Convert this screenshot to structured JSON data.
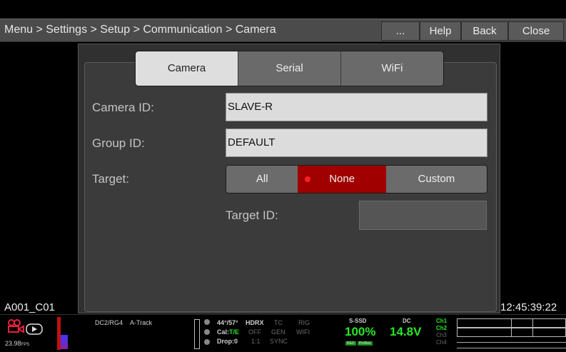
{
  "topbar": {
    "breadcrumb": "Menu > Settings > Setup > Communication > Camera",
    "buttons": [
      "...",
      "Help",
      "Back",
      "Close"
    ]
  },
  "tabs": [
    "Camera",
    "Serial",
    "WiFi"
  ],
  "form": {
    "camera_id_label": "Camera ID:",
    "camera_id_value": "SLAVE-R",
    "group_id_label": "Group ID:",
    "group_id_value": "DEFAULT",
    "target_label": "Target:",
    "target_options": [
      "All",
      "None",
      "Custom"
    ],
    "target_selected": "None",
    "target_id_label": "Target ID:",
    "target_id_value": ""
  },
  "clip_name": "A001_C01",
  "timecode": "12:45:39:22",
  "status": {
    "fps": "23.98",
    "fps_unit": "FPS",
    "storage_label": "DC2/RG4",
    "track_label": "A-Track",
    "temp": "44°/57°",
    "cal_label": "Cal:",
    "cal_value": "T/E",
    "drop": "Drop:0",
    "hdrx": "HDRX",
    "hdrx_value": "OFF",
    "hdrx_ratio": "1:1",
    "tc_label": "TC",
    "tc_value": "GEN",
    "tc_sync": "SYNC",
    "rig_label": "RIG",
    "rig_value": "WIFI",
    "media_label": "S-SSD",
    "media_percent": "100%",
    "media_badge_1": "RED",
    "media_badge_2": "ProRes",
    "power_label": "DC",
    "power_value": "14.8V",
    "channels": [
      "Ch1",
      "Ch2",
      "Ch3",
      "Ch4"
    ]
  },
  "colors": {
    "selected": "#a00000",
    "active_tab": "#dedede",
    "green": "#29e629",
    "record_icon": "#e8223a"
  }
}
